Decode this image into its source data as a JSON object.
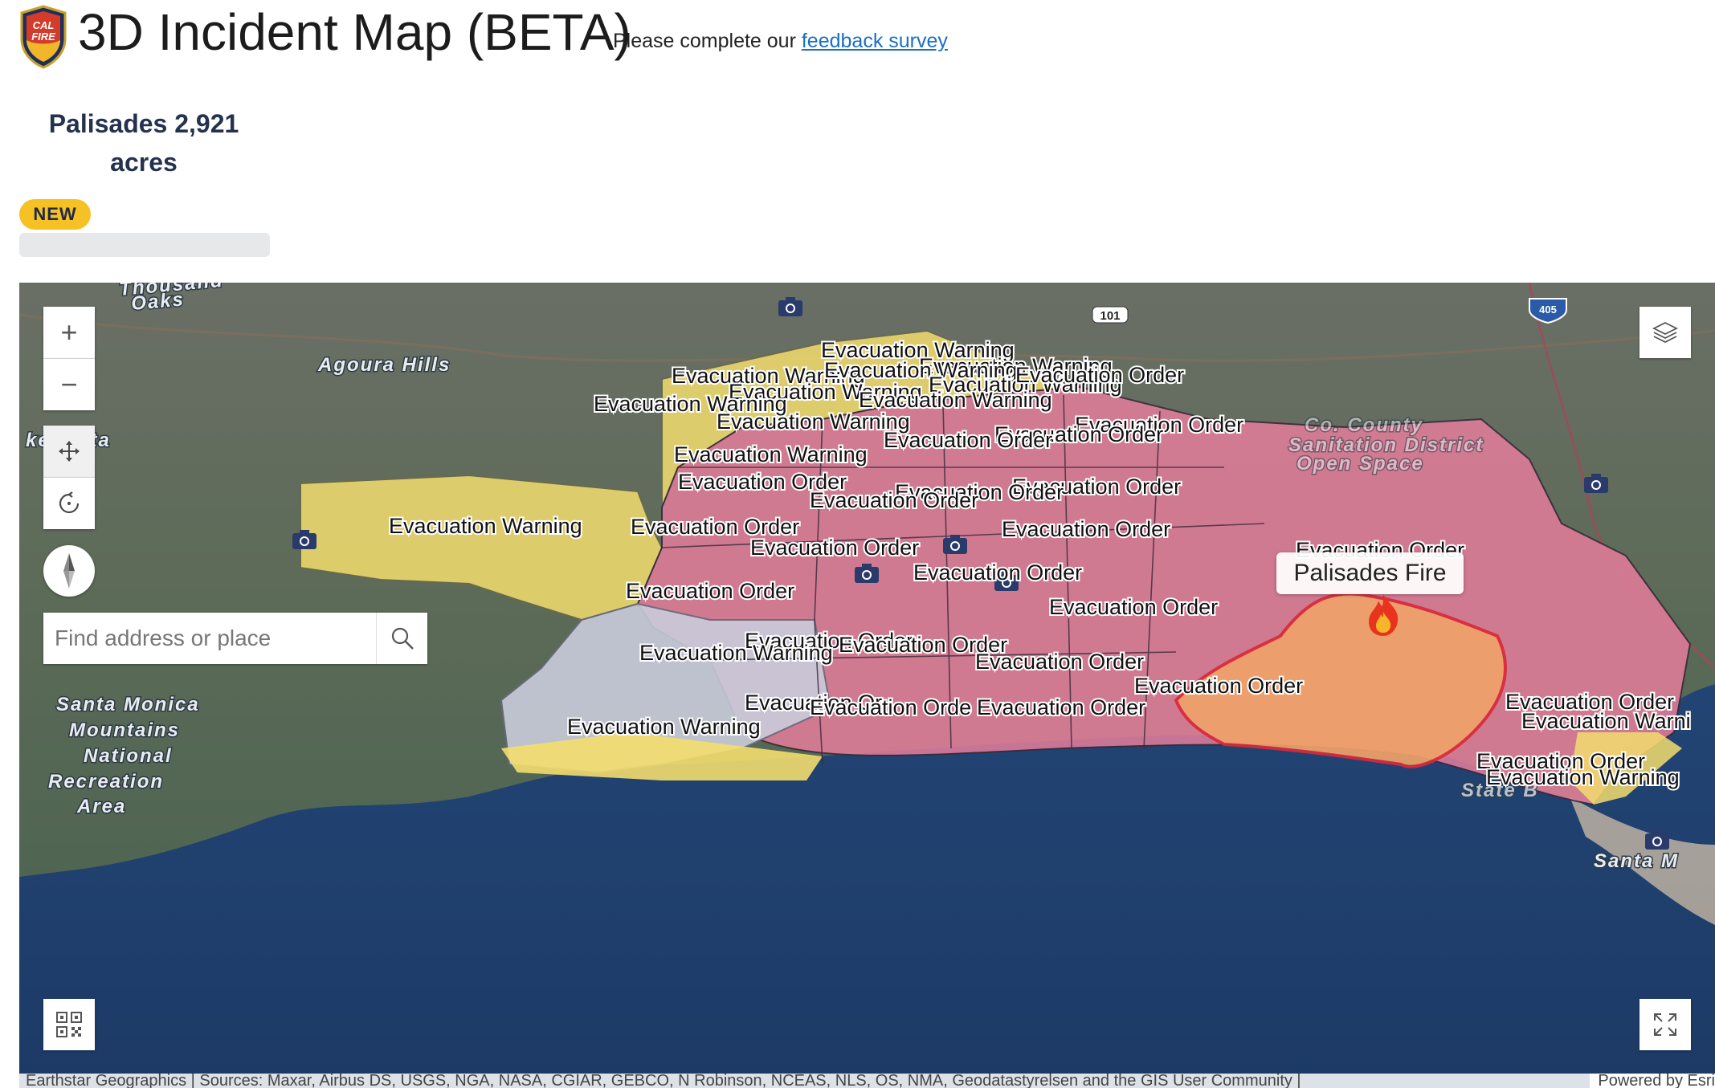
{
  "header": {
    "title": "3D Incident Map (BETA)",
    "feedback_prefix": "Please complete our",
    "feedback_link": "feedback survey",
    "logo_text_top": "CAL",
    "logo_text_bottom": "FIRE"
  },
  "incident": {
    "name_line": "Palisades 2,921",
    "unit_line": "acres",
    "badge": "NEW"
  },
  "map": {
    "search": {
      "placeholder": "Find address or place"
    },
    "controls": {
      "zoom_in": "+",
      "zoom_out": "−"
    },
    "popup": "Palisades Fire",
    "places": {
      "thousand_oaks_1": "Thousand",
      "thousand_oaks_2": "Oaks",
      "agoura_hills": "Agoura Hills",
      "lake_vista": "ke Vista",
      "smm_1": "Santa Monica",
      "smm_2": "Mountains",
      "smm_3": "National",
      "smm_4": "Recreation",
      "smm_5": "Area",
      "santa_m": "Santa M",
      "sanitation_1": "Co. County",
      "sanitation_2": "Sanitation District",
      "sanitation_3": "Open Space",
      "state_b": "State B",
      "highway_101": "101",
      "highway_405": "405"
    },
    "labels": {
      "warning": "Evacuation Warning",
      "order": "Evacuation Order",
      "warning_cut": "Evacuation Warni",
      "order_cut": "Evacuation Or",
      "order_cut2": "Evacuation Orde"
    },
    "attribution": {
      "left": "Earthstar Geographics | Sources: Maxar, Airbus DS, USGS, NGA, NASA, CGIAR, GEBCO, N Robinson, NCEAS, NLS, OS, NMA, Geodatastyrelsen and the GIS User Community |",
      "right": "Powered by Esri"
    },
    "colors": {
      "order_zone": "#e07d9a",
      "warning_zone": "#f3dd6e",
      "perimeter": "#d92a3a",
      "ocean": "#24497a",
      "terrain": "#5f6a5c"
    }
  }
}
